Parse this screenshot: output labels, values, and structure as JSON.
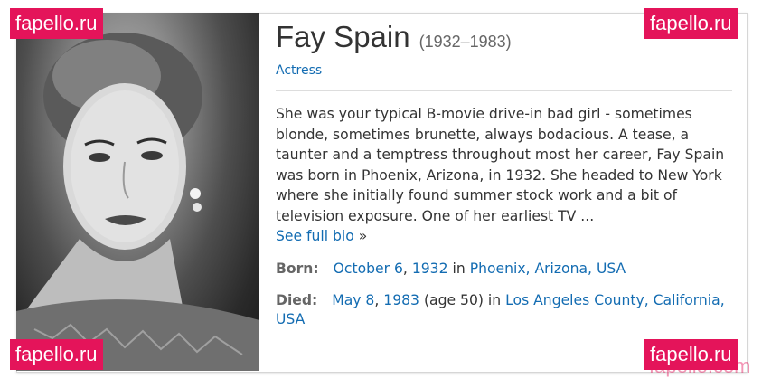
{
  "profile": {
    "name": "Fay Spain",
    "years": "(1932–1983)",
    "profession": "Actress",
    "bio": "She was your typical B-movie drive-in bad girl - sometimes blonde, sometimes brunette, always bodacious. A tease, a taunter and a temptress throughout most her career, Fay Spain was born in Phoenix, Arizona, in 1932. She headed to New York where she initially found summer stock work and a bit of television exposure. One of her earliest TV ...",
    "bio_link": "See full bio",
    "bio_link_suffix": "»"
  },
  "born": {
    "label": "Born:",
    "date": "October 6",
    "sep": ",",
    "year": "1932",
    "in": "in",
    "place": "Phoenix, Arizona, USA"
  },
  "died": {
    "label": "Died:",
    "date": "May 8",
    "sep": ",",
    "year": "1983",
    "age": "(age 50) in",
    "place": "Los Angeles County, California, USA"
  },
  "watermark": {
    "text": "fapello.ru",
    "ghost": "fapello.com"
  },
  "colors": {
    "link": "#136cb2",
    "watermark": "#e4145a"
  }
}
